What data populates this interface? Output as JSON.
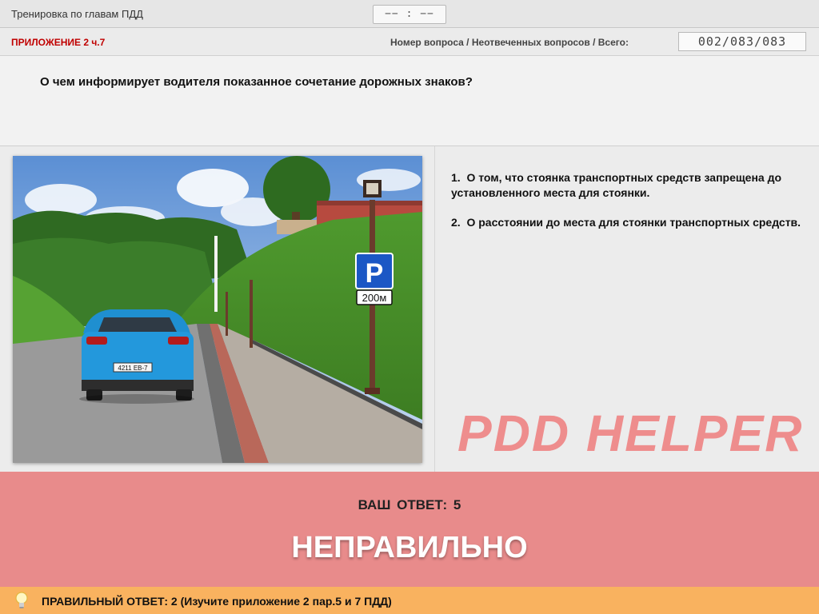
{
  "header": {
    "title": "Тренировка по главам ПДД",
    "timer": "−− : −−"
  },
  "info": {
    "section": "ПРИЛОЖЕНИЕ 2 ч.7",
    "counter_label": "Номер вопроса / Неотвеченных вопросов / Всего:",
    "counter_value": "002/083/083"
  },
  "question": {
    "text": "О чем информирует водителя показанное сочетание дорожных знаков?"
  },
  "picture": {
    "sign_letter": "P",
    "plate_text": "200м",
    "car_plate": "4211 EB-7"
  },
  "answers": [
    {
      "num": "1.",
      "text": "О том, что стоянка транспортных средств запрещена до установленного места для стоянки."
    },
    {
      "num": "2.",
      "text": "О расстоянии до места для стоянки транспортных средств."
    }
  ],
  "watermark": "PDD HELPER",
  "result": {
    "your_answer": "ВАШ ОТВЕТ: 5",
    "verdict": "НЕПРАВИЛЬНО"
  },
  "footer": {
    "correct_answer": "ПРАВИЛЬНЫЙ ОТВЕТ: 2 (Изучите приложение 2 пар.5 и 7 ПДД)",
    "icon": "lightbulb-icon"
  },
  "colors": {
    "result_bg": "#e88b8b",
    "footer_bg": "#f9b25f",
    "section_red": "#c00000",
    "sign_blue": "#1b57c5"
  }
}
